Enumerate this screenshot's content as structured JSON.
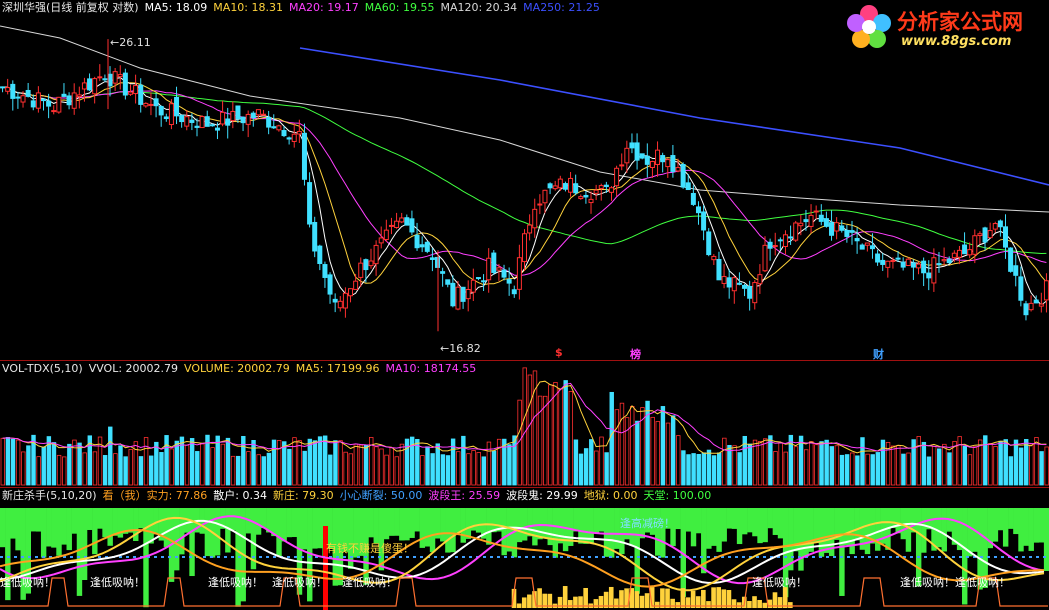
{
  "logo": {
    "title": "分析家公式网",
    "url": "www.88gs.com"
  },
  "main": {
    "header": [
      {
        "text": "深圳华强(日线 前复权 对数)",
        "color": "#e8e8e8"
      },
      {
        "text": "MA5: 18.09",
        "color": "#ffffff"
      },
      {
        "text": "MA10: 18.31",
        "color": "#ffd23c"
      },
      {
        "text": "MA20: 19.17",
        "color": "#ff40ff"
      },
      {
        "text": "MA60: 19.55",
        "color": "#40ff40"
      },
      {
        "text": "MA120: 20.34",
        "color": "#d8d8d8"
      },
      {
        "text": "MA250: 21.25",
        "color": "#3c50ff"
      }
    ],
    "high_label": "26.11",
    "low_label": "16.82",
    "events": [
      {
        "text": "$",
        "color": "#ff3030"
      },
      {
        "text": "榜",
        "color": "#ff40ff"
      },
      {
        "text": "财",
        "color": "#40a0ff"
      }
    ]
  },
  "volume": {
    "header": [
      {
        "text": "VOL-TDX(5,10)",
        "color": "#e8e8e8"
      },
      {
        "text": "VVOL: 20002.79",
        "color": "#e8e8e8"
      },
      {
        "text": "VOLUME: 20002.79",
        "color": "#ffd23c"
      },
      {
        "text": "MA5: 17199.96",
        "color": "#ffd23c"
      },
      {
        "text": "MA10: 18174.55",
        "color": "#ff40ff"
      }
    ]
  },
  "indicator": {
    "header": [
      {
        "text": "新庄杀手(5,10,20)",
        "color": "#e8e8e8"
      },
      {
        "text": "看（我）实力: 77.86",
        "color": "#ffa020"
      },
      {
        "text": "散户: 0.34",
        "color": "#ffffff"
      },
      {
        "text": "新庄: 79.30",
        "color": "#ffd23c"
      },
      {
        "text": "小心断裂: 50.00",
        "color": "#40a0ff"
      },
      {
        "text": "波段王: 25.59",
        "color": "#ff40ff"
      },
      {
        "text": "波段鬼: 29.99",
        "color": "#ffffff"
      },
      {
        "text": "地狱: 0.00",
        "color": "#ffd23c"
      },
      {
        "text": "天堂: 100.00",
        "color": "#40ff40"
      }
    ],
    "annotations": {
      "gao": "逢高减磅！",
      "money": "有钱不赚是傻蛋！",
      "low": "逢低吸呐！"
    }
  },
  "chart_data": {
    "type": "candlestick",
    "title": "深圳华强(日线 前复权 对数)",
    "price_range": [
      16.82,
      26.11
    ],
    "scale": "log",
    "moving_averages": {
      "MA5": 18.09,
      "MA10": 18.31,
      "MA20": 19.17,
      "MA60": 19.55,
      "MA120": 20.34,
      "MA250": 21.25
    },
    "max_price": 26.11,
    "min_price": 16.82,
    "volume": {
      "VVOL": 20002.79,
      "VOLUME": 20002.79,
      "MA5": 17199.96,
      "MA10": 18174.55
    },
    "indicator_values": {
      "看（我）实力": 77.86,
      "散户": 0.34,
      "新庄": 79.3,
      "小心断裂": 50.0,
      "波段王": 25.59,
      "波段鬼": 29.99,
      "地狱": 0.0,
      "天堂": 100.0
    }
  }
}
